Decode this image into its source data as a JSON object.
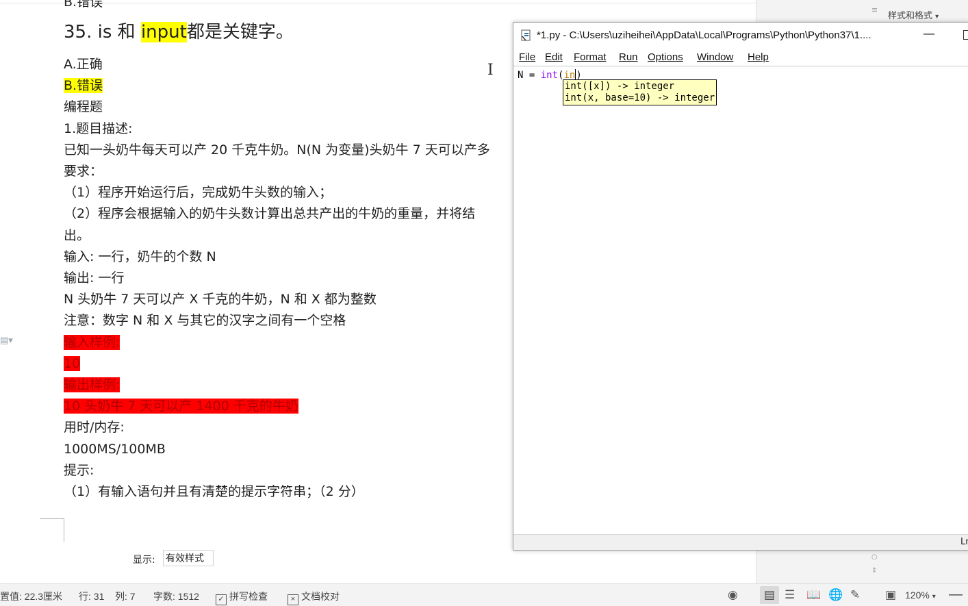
{
  "document": {
    "clipped_top": "B.错误",
    "question": {
      "number": "35.",
      "part1": "is 和",
      "keyword": "input",
      "part2": "都是关键字。"
    },
    "options": {
      "a": "A.正确",
      "b": "B.错误"
    },
    "section_title": "编程题",
    "lines": [
      "1.题目描述:",
      "已知一头奶牛每天可以产 20 千克牛奶。N(N 为变量)头奶牛 7 天可以产多",
      "要求：",
      "（1）程序开始运行后，完成奶牛头数的输入；",
      "（2）程序会根据输入的奶牛头数计算出总共产出的牛奶的重量，并将结",
      "出。",
      "输入: 一行，奶牛的个数 N",
      "输出: 一行",
      "N  头奶牛 7 天可以产  X  千克的牛奶，N 和 X 都为整数",
      "注意：数字 N 和 X 与其它的汉字之间有一个空格"
    ],
    "sample_input_label": "输入样例:",
    "sample_input_value": "10",
    "sample_output_label": "输出样例:",
    "sample_output_value": "10  头奶牛  7  天可以产  1400  千克的牛奶",
    "lines2": [
      "用时/内存:",
      "1000MS/100MB",
      "提示:",
      "（1）有输入语句并且有清楚的提示字符串；（2 分）"
    ]
  },
  "idle": {
    "title": "*1.py - C:\\Users\\uziheihei\\AppData\\Local\\Programs\\Python\\Python37\\1....",
    "menu": [
      "File",
      "Edit",
      "Format",
      "Run",
      "Options",
      "Window",
      "Help"
    ],
    "code": {
      "prefix": "N = ",
      "builtin": "int",
      "open_paren": "(",
      "partial": "in",
      "close_paren": ")"
    },
    "calltip": {
      "line1": "int([x]) -> integer",
      "line2": "int(x, base=10) -> integer"
    },
    "status": "Ln"
  },
  "pane": {
    "title": "样式和格式",
    "show_label": "显示:",
    "show_value": "有效样式"
  },
  "statusbar": {
    "position": "置值: 22.3厘米",
    "row": "行: 31",
    "col": "列: 7",
    "word_count": "字数: 1512",
    "spell_check": "拼写检查",
    "doc_check": "文档校对",
    "zoom": "120%"
  }
}
